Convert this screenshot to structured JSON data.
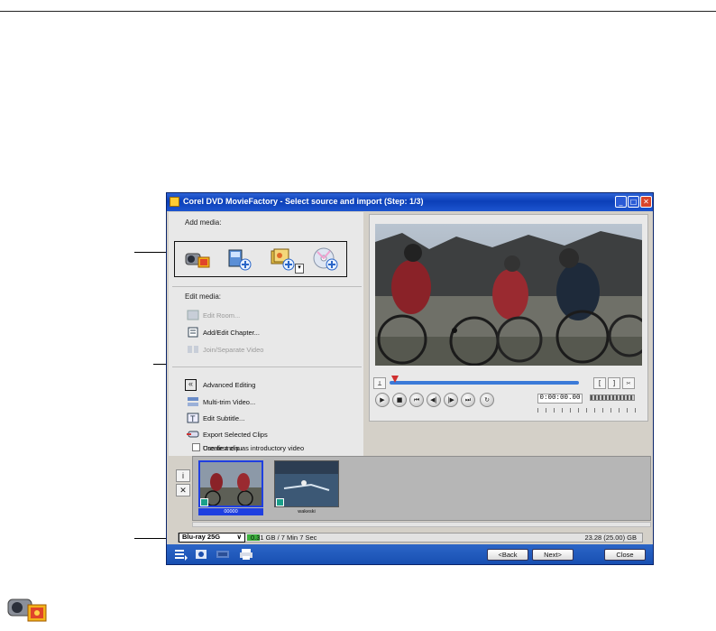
{
  "window": {
    "title": "Corel DVD MovieFactory - Select source and import (Step: 1/3)",
    "controls": {
      "minimize": "_",
      "maximize": "□",
      "close": "✕"
    }
  },
  "add_media": {
    "label": "Add media:",
    "icons": [
      "camcorder-icon",
      "import-video-icon",
      "import-photo-icon",
      "import-disc-icon"
    ],
    "dropdown_arrow": "▾"
  },
  "edit_media": {
    "label": "Edit media:",
    "items": [
      {
        "label": "Edit Room...",
        "enabled": false,
        "icon": "edit-room-icon"
      },
      {
        "label": "Add/Edit Chapter...",
        "enabled": true,
        "icon": "chapter-icon"
      },
      {
        "label": "Join/Separate Video",
        "enabled": false,
        "icon": "join-video-icon"
      }
    ]
  },
  "advanced_editing": {
    "toggle": "«",
    "label": "Advanced Editing",
    "items": [
      {
        "label": "Multi-trim Video...",
        "icon": "multi-trim-icon"
      },
      {
        "label": "Edit Subtitle...",
        "icon": "subtitle-icon"
      },
      {
        "label": "Export Selected Clips",
        "icon": "export-clips-icon"
      }
    ]
  },
  "options": [
    {
      "label": "Create menu",
      "checked": true
    },
    {
      "label": "Use first clip as introductory video",
      "checked": false
    }
  ],
  "player": {
    "timecode": "0:00:00.00",
    "mark_in": "[",
    "mark_out": "]",
    "cut": "✂",
    "buttons": [
      "▶",
      "■",
      "⏮",
      "◀|",
      "|▶",
      "⏭",
      "↻"
    ]
  },
  "clips": {
    "info_button": "i",
    "delete_button": "✕",
    "items": [
      {
        "caption": "00000",
        "selected": true
      },
      {
        "caption": "wakeski",
        "selected": false
      }
    ]
  },
  "status": {
    "disc": "Blu-ray 25G",
    "arrow": "∨",
    "used": "0.31 GB / 7 Min 7 Sec",
    "capacity": "23.28 (25.00) GB"
  },
  "navigation": {
    "back": "<Back",
    "next": "Next>",
    "close": "Close"
  }
}
